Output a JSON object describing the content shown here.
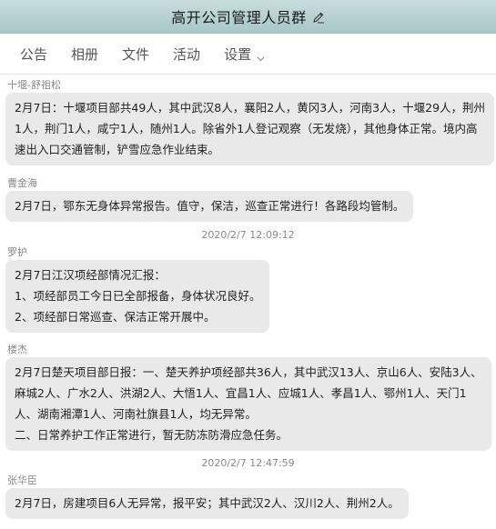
{
  "header": {
    "title": "高开公司管理人员群",
    "edit_icon": "pencil-icon"
  },
  "tabs": [
    {
      "label": "公告"
    },
    {
      "label": "相册"
    },
    {
      "label": "文件"
    },
    {
      "label": "活动"
    },
    {
      "label": "设置",
      "icon": "chevron-down-icon"
    }
  ],
  "messages": [
    {
      "sender": "十堰-舒祖松",
      "lines": [
        "2月7日：十堰项目部共49人，其中武汉8人，襄阳2人，黄冈3人，河南3人，十堰29人，荆州",
        "1人，荆门1人，咸宁1人，随州1人。除省外1人登记观察（无发烧），其他身体正常。境内高",
        "速出入口交通管制，铲雪应急作业结束。"
      ]
    },
    {
      "sender": "曹金海",
      "lines": [
        "2月7日，鄂东无身体异常报告。值守，保洁，巡查正常进行！各路段均管制。"
      ]
    },
    {
      "timestamp": "2020/2/7 12:09:12"
    },
    {
      "sender": "罗护",
      "lines": [
        "2月7日江汉项经部情况汇报：",
        "1、项经部员工今日已全部报备，身体状况良好。",
        "2、项经部日常巡查、保洁正常开展中。"
      ]
    },
    {
      "sender": "楼杰",
      "lines": [
        "2月7日楚天项目部日报：一、楚天养护项经部共36人，其中武汉13人、京山6人、安陆3人、",
        "麻城2人、广水2人、洪湖2人、大悟1人、宜昌1人、应城1人、孝昌1人、鄂州1人、天门1",
        "人、湖南湘潭1人、河南社旗县1人，均无异常。",
        "二、日常养护工作正常进行，暂无防冻防滑应急任务。"
      ]
    },
    {
      "timestamp": "2020/2/7 12:47:59"
    },
    {
      "sender": "张华臣",
      "lines": [
        "2月7日，房建项目6人无异常，报平安；其中武汉2人、汉川2人、荆州2人。"
      ]
    }
  ]
}
